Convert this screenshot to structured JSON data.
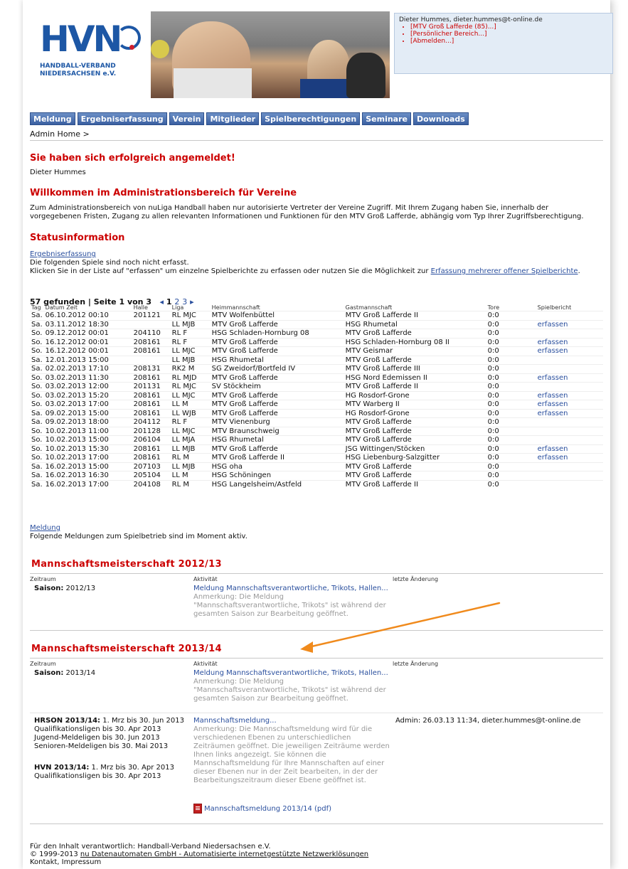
{
  "header": {
    "logo": {
      "text": "HVN",
      "sub_line1": "HANDBALL-VERBAND",
      "sub_line2": "NIEDERSACHSEN e.V."
    },
    "login": {
      "user": "Dieter Hummes, dieter.hummes@t-online.de",
      "links": [
        "[MTV Groß Lafferde (85)...]",
        "[Persönlicher Bereich...]",
        "[Abmelden...]"
      ]
    }
  },
  "nav": [
    "Meldung",
    "Ergebniserfassung",
    "Verein",
    "Mitglieder",
    "Spielberechtigungen",
    "Seminare",
    "Downloads"
  ],
  "breadcrumb": "Admin Home >",
  "success": {
    "title": "Sie haben sich erfolgreich angemeldet!",
    "name": "Dieter Hummes"
  },
  "welcome": {
    "title": "Willkommen im Administrationsbereich für Vereine",
    "text1": "Zum Administrationsbereich von nuLiga Handball haben nur autorisierte Vertreter der Vereine Zugriff. Mit Ihrem Zugang haben Sie, innerhalb der",
    "text2": "vorgegebenen Fristen, Zugang zu allen relevanten Informationen und Funktionen für den MTV Groß Lafferde, abhängig vom Typ Ihrer Zugriffsberechtigung."
  },
  "status": {
    "title": "Statusinformation",
    "link": "Ergebniserfassung",
    "line1": "Die folgenden Spiele sind noch nicht erfasst.",
    "line2_pre": "Klicken Sie in der Liste auf \"erfassen\" um einzelne Spielberichte zu erfassen oder nutzen Sie die Möglichkeit zur ",
    "line2_link": "Erfassung mehrerer offener Spielberichte",
    "line2_post": "."
  },
  "pager": {
    "summary": "57 gefunden | Seite 1 von 3",
    "prev": "◂",
    "current": "1",
    "p2": "2",
    "p3": "3",
    "next": "▸"
  },
  "games_table": {
    "headers": [
      "Tag",
      "Datum Zeit",
      "Halle",
      "Liga",
      "Heimmannschaft",
      "Gastmannschaft",
      "Tore",
      "Spielbericht"
    ],
    "rows": [
      [
        "Sa.",
        "06.10.2012 00:10",
        "201121",
        "RL MJC",
        "MTV Wolfenbüttel",
        "MTV Groß Lafferde II",
        "0:0",
        ""
      ],
      [
        "Sa.",
        "03.11.2012 18:30",
        "",
        "LL MJB",
        "MTV Groß Lafferde",
        "HSG Rhumetal",
        "0:0",
        "erfassen"
      ],
      [
        "So.",
        "09.12.2012 00:01",
        "204110",
        "RL F",
        "HSG Schladen-Hornburg 08",
        "MTV Groß Lafferde",
        "0:0",
        ""
      ],
      [
        "So.",
        "16.12.2012 00:01",
        "208161",
        "RL F",
        "MTV Groß Lafferde",
        "HSG Schladen-Hornburg 08 II",
        "0:0",
        "erfassen"
      ],
      [
        "So.",
        "16.12.2012 00:01",
        "208161",
        "LL MJC",
        "MTV Groß Lafferde",
        "MTV Geismar",
        "0:0",
        "erfassen"
      ],
      [
        "Sa.",
        "12.01.2013 15:00",
        "",
        "LL MJB",
        "HSG Rhumetal",
        "MTV Groß Lafferde",
        "0:0",
        ""
      ],
      [
        "Sa.",
        "02.02.2013 17:10",
        "208131",
        "RK2 M",
        "SG Zweidorf/Bortfeld IV",
        "MTV Groß Lafferde III",
        "0:0",
        ""
      ],
      [
        "So.",
        "03.02.2013 11:30",
        "208161",
        "RL MJD",
        "MTV Groß Lafferde",
        "HSG Nord Edemissen II",
        "0:0",
        "erfassen"
      ],
      [
        "So.",
        "03.02.2013 12:00",
        "201131",
        "RL MJC",
        "SV Stöckheim",
        "MTV Groß Lafferde II",
        "0:0",
        ""
      ],
      [
        "So.",
        "03.02.2013 15:20",
        "208161",
        "LL MJC",
        "MTV Groß Lafferde",
        "HG Rosdorf-Grone",
        "0:0",
        "erfassen"
      ],
      [
        "So.",
        "03.02.2013 17:00",
        "208161",
        "LL M",
        "MTV Groß Lafferde",
        "MTV Warberg II",
        "0:0",
        "erfassen"
      ],
      [
        "Sa.",
        "09.02.2013 15:00",
        "208161",
        "LL WJB",
        "MTV Groß Lafferde",
        "HG Rosdorf-Grone",
        "0:0",
        "erfassen"
      ],
      [
        "Sa.",
        "09.02.2013 18:00",
        "204112",
        "RL F",
        "MTV Vienenburg",
        "MTV Groß Lafferde",
        "0:0",
        ""
      ],
      [
        "So.",
        "10.02.2013 11:00",
        "201128",
        "LL MJC",
        "MTV Braunschweig",
        "MTV Groß Lafferde",
        "0:0",
        ""
      ],
      [
        "So.",
        "10.02.2013 15:00",
        "206104",
        "LL MJA",
        "HSG Rhumetal",
        "MTV Groß Lafferde",
        "0:0",
        ""
      ],
      [
        "So.",
        "10.02.2013 15:30",
        "208161",
        "LL MJB",
        "MTV Groß Lafferde",
        "JSG Wittingen/Stöcken",
        "0:0",
        "erfassen"
      ],
      [
        "So.",
        "10.02.2013 17:00",
        "208161",
        "RL M",
        "MTV Groß Lafferde II",
        "HSG Liebenburg-Salzgitter",
        "0:0",
        "erfassen"
      ],
      [
        "Sa.",
        "16.02.2013 15:00",
        "207103",
        "LL MJB",
        "HSG oha",
        "MTV Groß Lafferde",
        "0:0",
        ""
      ],
      [
        "Sa.",
        "16.02.2013 16:30",
        "205104",
        "LL M",
        "HSG Schöningen",
        "MTV Groß Lafferde",
        "0:0",
        ""
      ],
      [
        "Sa.",
        "16.02.2013 17:00",
        "204108",
        "RL M",
        "HSG Langelsheim/Astfeld",
        "MTV Groß Lafferde II",
        "0:0",
        ""
      ]
    ]
  },
  "meldung": {
    "link": "Meldung",
    "text": "Folgende Meldungen zum Spielbetrieb sind im Moment aktiv."
  },
  "ms1213": {
    "title": "Mannschaftsmeisterschaft  2012/13",
    "col1": "Zeitraum",
    "col2": "Aktivität",
    "col3": "letzte Änderung",
    "saison_label": "Saison:",
    "saison_value": "2012/13",
    "activity": "Meldung Mannschaftsverantwortliche, Trikots, Hallen...",
    "note1": "Anmerkung: Die Meldung",
    "note2": "\"Mannschaftsverantwortliche, Trikots\" ist während der",
    "note3": "gesamten Saison zur Bearbeitung geöffnet."
  },
  "ms1314": {
    "title": "Mannschaftsmeisterschaft  2013/14",
    "col1": "Zeitraum",
    "col2": "Aktivität",
    "col3": "letzte Änderung",
    "saison_label": "Saison:",
    "saison_value": "2013/14",
    "activity": "Meldung Mannschaftsverantwortliche, Trikots, Hallen...",
    "note1": "Anmerkung: Die Meldung",
    "note2": "\"Mannschaftsverantwortliche, Trikots\" ist während der",
    "note3": "gesamten Saison zur Bearbeitung geöffnet.",
    "hrson_label": "HRSON 2013/14:",
    "hrson_value": "1. Mrz bis 30. Jun 2013",
    "hrson_l2": "Qualifikationsligen bis 30. Apr 2013",
    "hrson_l3": "Jugend-Meldeligen bis 30. Jun 2013",
    "hrson_l4": "Senioren-Meldeligen bis 30. Mai 2013",
    "hvn_label": "HVN 2013/14:",
    "hvn_value": "1. Mrz bis 30. Apr 2013",
    "hvn_l2": "Qualifikationsligen bis 30. Apr 2013",
    "activity2": "Mannschaftsmeldung...",
    "note2_lines": [
      "Anmerkung: Die Mannschaftsmeldung wird für die",
      "verschiedenen Ebenen zu unterschiedlichen",
      "Zeiträumen geöffnet. Die jeweiligen Zeiträume werden",
      "Ihnen links angezeigt. Sie können die",
      "Mannschaftsmeldung für Ihre Mannschaften auf einer",
      "dieser Ebenen nur in der Zeit bearbeiten, in der der",
      "Bearbeitungszeitraum dieser Ebene geöffnet ist."
    ],
    "last_change": "Admin: 26.03.13 11:34, dieter.hummes@t-online.de",
    "pdf": "Mannschaftsmeldung 2013/14 (pdf)"
  },
  "footer": {
    "line1": "Für den Inhalt verantwortlich: Handball-Verband Niedersachsen e.V.",
    "copy": "© 1999-2013 ",
    "company": "nu Datenautomaten GmbH - Automatisierte internetgestützte Netzwerklösungen",
    "line3": "Kontakt, Impressum"
  },
  "colors": {
    "accent": "#cc0000",
    "nav": "#3a5fa1",
    "link": "#2a4f9e",
    "arrow": "#f08a1c"
  }
}
